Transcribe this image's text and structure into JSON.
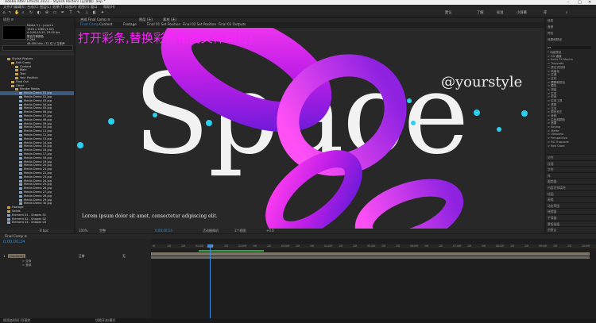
{
  "window": {
    "title": "Adobe After Effects 2022 - Stylish Posters (已转换) .aep *"
  },
  "menu": [
    "文件(F)",
    "编辑(E)",
    "合成(C)",
    "图层(L)",
    "效果(T)",
    "动画(A)",
    "视图(V)",
    "窗口",
    "帮助(H)"
  ],
  "workspaces": [
    "默认",
    "了解",
    "标准",
    "小屏幕",
    "库"
  ],
  "project": {
    "panel_title": "项目 ≡",
    "meta": "Media 3 (...).mp4 ▾\n1920 x 1080 (1.00)\nΔ 0;00;10;10, 25.00 fps\n数百万种颜色\nH.264\n48.000 kHz / 32 位 U 立体声",
    "items": [
      {
        "label": "Stylish Posters",
        "indent": 1,
        "type": "folder"
      },
      {
        "label": "Edit Comp",
        "indent": 2,
        "type": "folder"
      },
      {
        "label": "Content",
        "indent": 3,
        "type": "folder"
      },
      {
        "label": "Main",
        "indent": 3,
        "type": "folder"
      },
      {
        "label": "Text",
        "indent": 3,
        "type": "folder"
      },
      {
        "label": "Your Position",
        "indent": 3,
        "type": "folder"
      },
      {
        "label": "Final Out",
        "indent": 2,
        "type": "folder"
      },
      {
        "label": "Other",
        "indent": 2,
        "type": "folder"
      },
      {
        "label": "Render Media",
        "indent": 3,
        "type": "folder"
      },
      {
        "label": "Media Demo 01.jpg",
        "indent": 4,
        "type": "file",
        "selected": true
      },
      {
        "label": "Media Demo 02.jpg",
        "indent": 4,
        "type": "file"
      },
      {
        "label": "Media Demo 03.jpg",
        "indent": 4,
        "type": "file"
      },
      {
        "label": "Media Demo 04.jpg",
        "indent": 4,
        "type": "file"
      },
      {
        "label": "Media Demo 05.jpg",
        "indent": 4,
        "type": "file"
      },
      {
        "label": "Media Demo 06.jpg",
        "indent": 4,
        "type": "file"
      },
      {
        "label": "Media Demo 07.jpg",
        "indent": 4,
        "type": "file"
      },
      {
        "label": "Media Demo 08.jpg",
        "indent": 4,
        "type": "file"
      },
      {
        "label": "Media Demo 09.jpg",
        "indent": 4,
        "type": "file"
      },
      {
        "label": "Media Demo 10.jpg",
        "indent": 4,
        "type": "file"
      },
      {
        "label": "Media Demo 11.jpg",
        "indent": 4,
        "type": "file"
      },
      {
        "label": "Media Demo 12.jpg",
        "indent": 4,
        "type": "file"
      },
      {
        "label": "Media Demo 13.jpg",
        "indent": 4,
        "type": "file"
      },
      {
        "label": "Media Demo 14.jpg",
        "indent": 4,
        "type": "file"
      },
      {
        "label": "Media Demo 15.jpg",
        "indent": 4,
        "type": "file"
      },
      {
        "label": "Media Demo 16.jpg",
        "indent": 4,
        "type": "file"
      },
      {
        "label": "Media Demo 17.jpg",
        "indent": 4,
        "type": "file"
      },
      {
        "label": "Media Demo 18.jpg",
        "indent": 4,
        "type": "file"
      },
      {
        "label": "Media Demo 19.jpg",
        "indent": 4,
        "type": "file"
      },
      {
        "label": "Media Demo 20.jpg",
        "indent": 4,
        "type": "file"
      },
      {
        "label": "Media Demo 21.jpg",
        "indent": 4,
        "type": "file"
      },
      {
        "label": "Media Demo 22.jpg",
        "indent": 4,
        "type": "file"
      },
      {
        "label": "Media Demo 23.jpg",
        "indent": 4,
        "type": "file"
      },
      {
        "label": "Media Demo 24.jpg",
        "indent": 4,
        "type": "file"
      },
      {
        "label": "Media Demo 25.jpg",
        "indent": 4,
        "type": "file"
      },
      {
        "label": "Media Demo 26.jpg",
        "indent": 4,
        "type": "file"
      },
      {
        "label": "Media Demo 27.jpg",
        "indent": 4,
        "type": "file"
      },
      {
        "label": "Media Demo 28.jpg",
        "indent": 4,
        "type": "file"
      },
      {
        "label": "Media Demo 29.jpg",
        "indent": 4,
        "type": "file"
      },
      {
        "label": "Media Demo 30.jpg",
        "indent": 4,
        "type": "file"
      },
      {
        "label": "Footage",
        "indent": 1,
        "type": "folder"
      },
      {
        "label": "Solids",
        "indent": 1,
        "type": "folder"
      },
      {
        "label": "Element 01 - Shapes 01",
        "indent": 1,
        "type": "file"
      },
      {
        "label": "Element 02 - Shapes 02",
        "indent": 1,
        "type": "file"
      },
      {
        "label": "Element 03 - Shapes 03",
        "indent": 1,
        "type": "file"
      }
    ],
    "footer": "8 bpc"
  },
  "viewer": {
    "tabs": [
      "合成 Final Comp ≡",
      "图层 (无)",
      "素材 (无)"
    ],
    "subtabs": [
      "Final Comp",
      "Content",
      "Footage",
      "Final 01 Set Position",
      "Final 02 Set Position",
      "Final 03 Outputs"
    ],
    "overlay_instruction": "打开彩条,替换彩条相同文件即可!",
    "headline": "Space",
    "handle": "@yourstyle",
    "lorem": "Lorem ipsum dolor sit amet, consectetur adipiscing elit.",
    "zoom": "100%",
    "resolution": "完整",
    "timecode": "0;00;00;24",
    "camera": "活动摄像机",
    "view_count": "1个视图",
    "offset": "+0.0"
  },
  "right_panel": {
    "sections_top": [
      "信息",
      "音频",
      "预览",
      "效果和预设"
    ],
    "search_placeholder": "ρ▾",
    "effects": [
      "* 动画预设",
      "> 3D 通道",
      "> Boris FX Mocha",
      "> Trapcode",
      "> 表达式控制",
      "> 风格化",
      "> 过渡",
      "> 过时",
      "> 模糊和锐化",
      "> 模拟",
      "> 扭曲",
      "> 生成",
      "> 时间",
      "> 实用工具",
      "> 透视",
      "> 文本",
      "> 颜色校正",
      "> 音频",
      "> 杂色和颗粒",
      "> 遮罩",
      "> Keying",
      "> Matte",
      "> Obsolete",
      "> Perspective",
      "> RG Trapcode",
      "> Red Giant"
    ],
    "sections_bottom": [
      "对齐",
      "段落",
      "字符",
      "库",
      "跟踪器",
      "内容识别填充",
      "绘画",
      "画笔",
      "动态草图",
      "摇摆器",
      "平滑器",
      "蒙版插值",
      "创意云"
    ]
  },
  "timeline": {
    "tab": "Final Comp ≡",
    "timecode": "0;00;00;24",
    "layer": {
      "index": "1",
      "name": "[Content]",
      "mode": "正常",
      "parent": "无"
    },
    "sub_rows": [
      "> 变换",
      "> 音频"
    ],
    "ruler": [
      "0f",
      "10f",
      "20f",
      "01:00f",
      "10f",
      "20f",
      "02:00f",
      "10f",
      "20f",
      "03:00f",
      "10f",
      "20f",
      "04:00f",
      "10f",
      "20f",
      "05:00f",
      "10f",
      "20f",
      "06:00f",
      "10f",
      "20f",
      "07:00f",
      "10f",
      "20f",
      "08:00f",
      "10f",
      "20f",
      "09:00f",
      "10f",
      "20f",
      "10:00f"
    ],
    "status": [
      "帧渲染时间 32毫秒",
      "切换开关/模式"
    ]
  },
  "colors": {
    "accent": "#2f8bd6",
    "overlay": "#ff22ff",
    "magenta": "#ff1fd6",
    "violet": "#8a2be2",
    "teal": "#22c0e6"
  }
}
